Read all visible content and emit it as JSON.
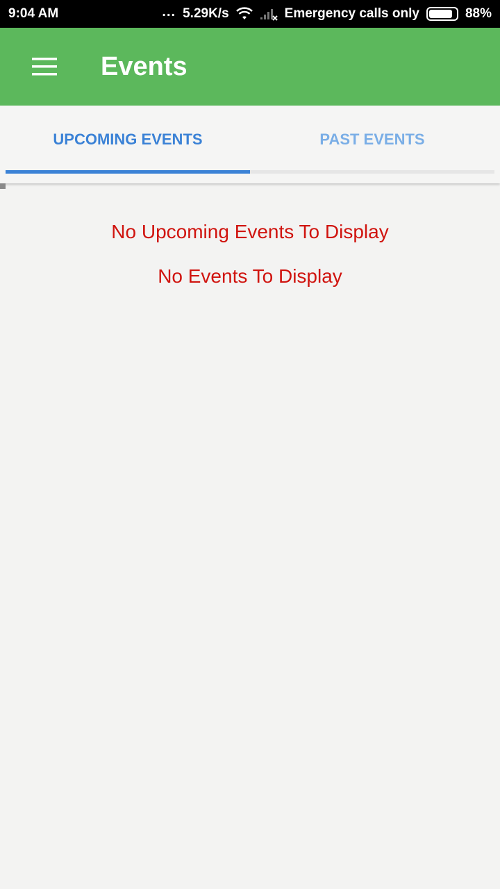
{
  "status_bar": {
    "time": "9:04 AM",
    "dots": "...",
    "net_speed": "5.29K/s",
    "carrier_text": "Emergency calls only",
    "battery_percent": "88%",
    "battery_level": 0.88,
    "icons": [
      "wifi-icon",
      "signal-none-icon",
      "battery-icon"
    ]
  },
  "app_bar": {
    "title": "Events",
    "menu_icon": "hamburger-menu-icon",
    "color": "#5cb85c"
  },
  "tabs": [
    {
      "label": "UPCOMING EVENTS",
      "selected": true
    },
    {
      "label": "PAST EVENTS",
      "selected": false
    }
  ],
  "content": {
    "upcoming_empty": "No Upcoming Events To Display",
    "events_empty": "No Events To Display"
  },
  "colors": {
    "accent": "#3b82d6",
    "error_text": "#d0140f",
    "background": "#f3f3f2"
  }
}
